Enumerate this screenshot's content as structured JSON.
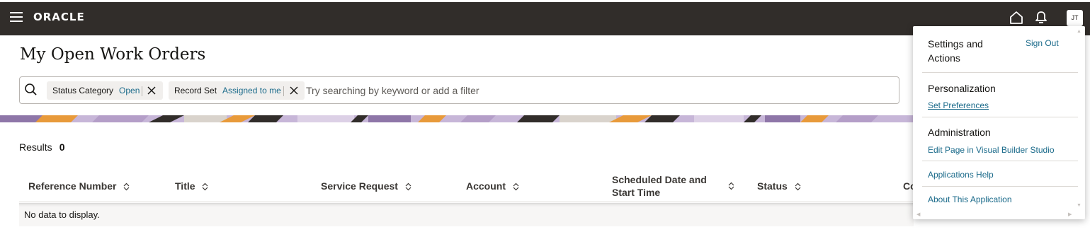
{
  "header": {
    "brand": "ORACLE",
    "avatar_initials": "JT",
    "bg_color": "#312d2a"
  },
  "page": {
    "title": "My Open Work Orders"
  },
  "search": {
    "placeholder": "Try searching by keyword or add a filter",
    "chips": [
      {
        "label": "Status Category",
        "value": "Open"
      },
      {
        "label": "Record Set",
        "value": "Assigned to me"
      }
    ]
  },
  "results": {
    "label": "Results",
    "count": "0"
  },
  "table": {
    "columns": [
      "Reference Number",
      "Title",
      "Service Request",
      "Account",
      "Scheduled Date and",
      "Start Time",
      "Status",
      "Co"
    ],
    "empty_text": "No data to display."
  },
  "panel": {
    "header_line1": "Settings and",
    "header_line2": "Actions",
    "sign_out": "Sign Out",
    "sections": [
      {
        "title": "Personalization",
        "link": "Set Preferences"
      },
      {
        "title": "Administration",
        "link": "Edit Page in Visual Builder Studio"
      }
    ],
    "help_link": "Applications Help",
    "about_link": "About This Application"
  },
  "colors": {
    "link": "#1a6a8a",
    "banner_purple": "#b49ec8",
    "banner_orange": "#e89a3a",
    "banner_dark": "#312d2a"
  }
}
